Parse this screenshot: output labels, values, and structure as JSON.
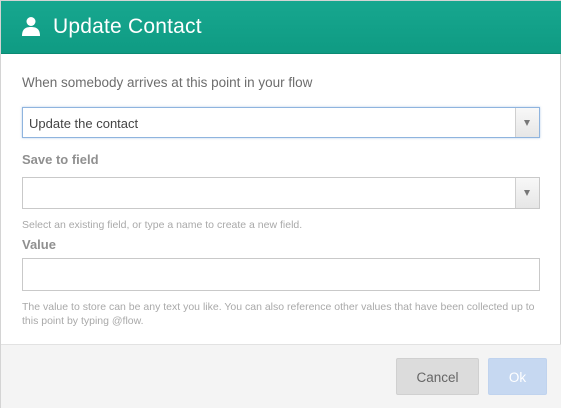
{
  "dialog": {
    "title": "Update Contact",
    "title_icon": "user-icon"
  },
  "form": {
    "intro": "When somebody arrives at this point in your flow",
    "action_select": {
      "selected": "Update the contact"
    },
    "save_field": {
      "label": "Save to field",
      "selected": "",
      "help": "Select an existing field, or type a name to create a new field."
    },
    "value": {
      "label": "Value",
      "current": "",
      "help": "The value to store can be any text you like. You can also reference other values that have been collected up to this point by typing @flow."
    }
  },
  "footer": {
    "cancel_label": "Cancel",
    "ok_label": "Ok"
  },
  "colors": {
    "header": "#12a188",
    "ok_button": "#c6d8f1",
    "cancel_button": "#dcdcdc"
  }
}
